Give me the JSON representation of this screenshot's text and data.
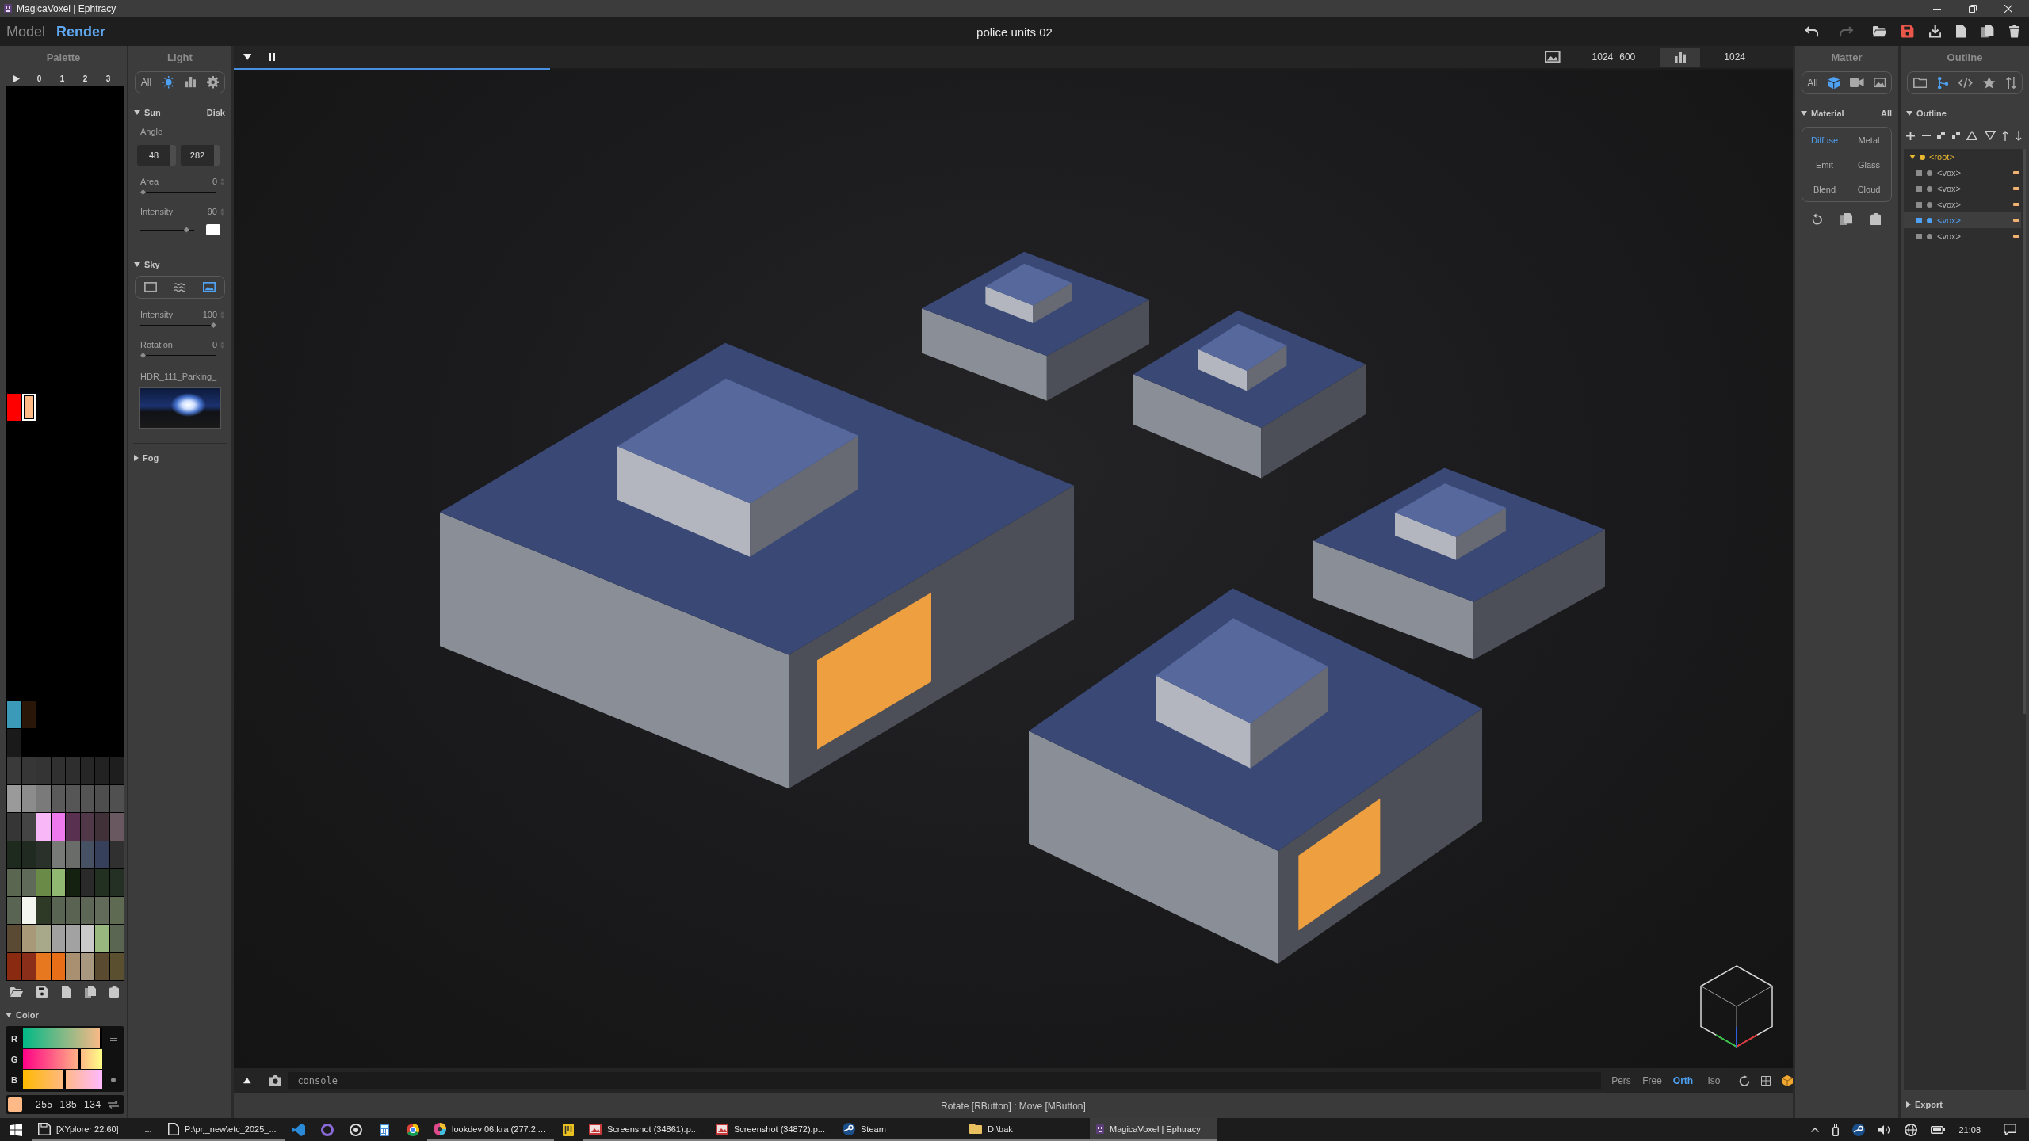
{
  "window": {
    "title": "MagicaVoxel | Ephtracy"
  },
  "toolbar": {
    "undo": {
      "disabled": false
    },
    "redo": {
      "disabled": true
    }
  },
  "modes": [
    {
      "label": "Model",
      "selected": false
    },
    {
      "label": "Render",
      "selected": true
    }
  ],
  "document": {
    "title": "police units 02"
  },
  "palette": {
    "title": "Palette",
    "pages": [
      {
        "label": "0",
        "selected": false
      },
      {
        "label": "1",
        "selected": false
      },
      {
        "label": "2",
        "selected": false
      },
      {
        "label": "3",
        "selected": false
      }
    ],
    "rows": [
      {
        "cells": [
          null,
          null,
          null,
          null,
          null,
          null,
          null,
          null
        ]
      },
      {
        "cells": [
          null,
          null,
          null,
          null,
          null,
          null,
          null,
          null
        ]
      },
      {
        "cells": [
          null,
          null,
          null,
          null,
          null,
          null,
          null,
          null
        ]
      },
      {
        "cells": [
          null,
          null,
          null,
          null,
          null,
          null,
          null,
          null
        ]
      },
      {
        "cells": [
          null,
          null,
          null,
          null,
          null,
          null,
          null,
          null
        ]
      },
      {
        "cells": [
          null,
          null,
          null,
          null,
          null,
          null,
          null,
          null
        ]
      },
      {
        "cells": [
          null,
          null,
          null,
          null,
          null,
          null,
          null,
          null
        ]
      },
      {
        "cells": [
          null,
          null,
          null,
          null,
          null,
          null,
          null,
          null
        ]
      },
      {
        "cells": [
          null,
          null,
          null,
          null,
          null,
          null,
          null,
          null
        ]
      },
      {
        "cells": [
          null,
          null,
          null,
          null,
          null,
          null,
          null,
          null
        ]
      },
      {
        "cells": [
          null,
          null,
          null,
          null,
          null,
          null,
          null,
          null
        ]
      },
      {
        "cells": [
          {
            "color": "#ff0000",
            "selected": false
          },
          {
            "color": "#ffb986",
            "selected": true
          },
          null,
          null,
          null,
          null,
          null,
          null
        ]
      },
      {
        "cells": [
          null,
          null,
          null,
          null,
          null,
          null,
          null,
          null
        ]
      },
      {
        "cells": [
          null,
          null,
          null,
          null,
          null,
          null,
          null,
          null
        ]
      },
      {
        "cells": [
          null,
          null,
          null,
          null,
          null,
          null,
          null,
          null
        ]
      },
      {
        "cells": [
          null,
          null,
          null,
          null,
          null,
          null,
          null,
          null
        ]
      },
      {
        "cells": [
          null,
          null,
          null,
          null,
          null,
          null,
          null,
          null
        ]
      },
      {
        "cells": [
          null,
          null,
          null,
          null,
          null,
          null,
          null,
          null
        ]
      },
      {
        "cells": [
          null,
          null,
          null,
          null,
          null,
          null,
          null,
          null
        ]
      },
      {
        "cells": [
          null,
          null,
          null,
          null,
          null,
          null,
          null,
          null
        ]
      },
      {
        "cells": [
          null,
          null,
          null,
          null,
          null,
          null,
          null,
          null
        ]
      },
      {
        "cells": [
          null,
          null,
          null,
          null,
          null,
          null,
          null,
          null
        ]
      },
      {
        "cells": [
          {
            "color": "#3a9ab8",
            "selected": false
          },
          {
            "color": "#2a1608",
            "selected": false
          },
          null,
          null,
          null,
          null,
          null,
          null
        ]
      },
      {
        "cells": [
          {
            "color": "#1a1a1a",
            "selected": false
          },
          null,
          null,
          null,
          null,
          null,
          null,
          null
        ]
      },
      {
        "cells": [
          {
            "color": "#3a3a3a",
            "selected": false
          },
          {
            "color": "#363636",
            "selected": false
          },
          {
            "color": "#343434",
            "selected": false
          },
          {
            "color": "#303030",
            "selected": false
          },
          {
            "color": "#2e2e2e",
            "selected": false
          },
          {
            "color": "#262626",
            "selected": false
          },
          {
            "color": "#222222",
            "selected": false
          },
          {
            "color": "#1e1e1e",
            "selected": false
          }
        ]
      },
      {
        "cells": [
          {
            "color": "#9a9a9a",
            "selected": false
          },
          {
            "color": "#8c8c8c",
            "selected": false
          },
          {
            "color": "#7a7a7a",
            "selected": false
          },
          {
            "color": "#5a5a5a",
            "selected": false
          },
          {
            "color": "#565656",
            "selected": false
          },
          {
            "color": "#545454",
            "selected": false
          },
          {
            "color": "#4e4e4e",
            "selected": false
          },
          {
            "color": "#505050",
            "selected": false
          }
        ]
      },
      {
        "cells": [
          {
            "color": "#363636",
            "selected": false
          },
          {
            "color": "#444444",
            "selected": false
          },
          {
            "color": "#f8b8f8",
            "selected": false
          },
          {
            "color": "#ee78ee",
            "selected": false
          },
          {
            "color": "#5a3050",
            "selected": false
          },
          {
            "color": "#503848",
            "selected": false
          },
          {
            "color": "#403038",
            "selected": false
          },
          {
            "color": "#6a5860",
            "selected": false
          }
        ]
      },
      {
        "cells": [
          {
            "color": "#1e2a1e",
            "selected": false
          },
          {
            "color": "#202a20",
            "selected": false
          },
          {
            "color": "#2a302a",
            "selected": false
          },
          {
            "color": "#787a78",
            "selected": false
          },
          {
            "color": "#6a6c6a",
            "selected": false
          },
          {
            "color": "#465264",
            "selected": false
          },
          {
            "color": "#36405a",
            "selected": false
          },
          {
            "color": "#303030",
            "selected": false
          }
        ]
      },
      {
        "cells": [
          {
            "color": "#5a6650",
            "selected": false
          },
          {
            "color": "#606a58",
            "selected": false
          },
          {
            "color": "#6a8a48",
            "selected": false
          },
          {
            "color": "#90b870",
            "selected": false
          },
          {
            "color": "#142010",
            "selected": false
          },
          {
            "color": "#2a2a2a",
            "selected": false
          },
          {
            "color": "#223022",
            "selected": false
          },
          {
            "color": "#243024",
            "selected": false
          }
        ]
      },
      {
        "cells": [
          {
            "color": "#5a6452",
            "selected": false
          },
          {
            "color": "#f2f6ee",
            "selected": false
          },
          {
            "color": "#2e3a26",
            "selected": false
          },
          {
            "color": "#5a6452",
            "selected": false
          },
          {
            "color": "#5a6252",
            "selected": false
          },
          {
            "color": "#5e6656",
            "selected": false
          },
          {
            "color": "#626a5a",
            "selected": false
          },
          {
            "color": "#5e6a52",
            "selected": false
          }
        ]
      },
      {
        "cells": [
          {
            "color": "#5a4a34",
            "selected": false
          },
          {
            "color": "#a89a78",
            "selected": false
          },
          {
            "color": "#a8a88a",
            "selected": false
          },
          {
            "color": "#a0a0a0",
            "selected": false
          },
          {
            "color": "#a2a2a2",
            "selected": false
          },
          {
            "color": "#cacaca",
            "selected": false
          },
          {
            "color": "#98b880",
            "selected": false
          },
          {
            "color": "#5a6652",
            "selected": false
          }
        ]
      },
      {
        "cells": [
          {
            "color": "#8a2a10",
            "selected": false
          },
          {
            "color": "#8a2e1a",
            "selected": false
          },
          {
            "color": "#e87820",
            "selected": false
          },
          {
            "color": "#e86e18",
            "selected": false
          },
          {
            "color": "#a89070",
            "selected": false
          },
          {
            "color": "#a89880",
            "selected": false
          },
          {
            "color": "#5a4a30",
            "selected": false
          },
          {
            "color": "#5a5030",
            "selected": false
          }
        ]
      }
    ]
  },
  "color": {
    "title": "Color",
    "expanded": true,
    "channels": [
      {
        "label": "R",
        "level": 1
      },
      {
        "label": "G",
        "level": 0.725
      },
      {
        "label": "B",
        "level": 0.525
      }
    ],
    "values": [
      "255",
      "185",
      "134"
    ]
  },
  "light": {
    "title": "Light",
    "filters": [
      {
        "kind": "text",
        "label": "All",
        "selected": false
      },
      {
        "kind": "sun",
        "selected": true
      },
      {
        "kind": "chart",
        "selected": false
      },
      {
        "kind": "gear",
        "selected": false
      }
    ],
    "sun": {
      "title": "Sun",
      "expanded": true,
      "mode": "Disk",
      "angle_label": "Angle",
      "angle": [
        "48",
        "282"
      ],
      "area": {
        "label": "Area",
        "value": "0",
        "level": 0
      },
      "intensity": {
        "label": "Intensity",
        "value": "90",
        "level": 0.9
      }
    },
    "sky": {
      "title": "Sky",
      "expanded": true,
      "types": [
        {
          "kind": "plain",
          "selected": false
        },
        {
          "kind": "waves",
          "selected": false
        },
        {
          "kind": "image",
          "selected": true
        }
      ],
      "intensity": {
        "label": "Intensity",
        "value": "100",
        "level": 1
      },
      "rotation": {
        "label": "Rotation",
        "value": "0",
        "level": 0
      },
      "hdr_name": "HDR_111_Parking_"
    },
    "fog": {
      "title": "Fog",
      "expanded": false
    }
  },
  "viewport": {
    "progress": {
      "level": 0.203
    },
    "size": [
      "1024",
      "600"
    ],
    "samples": "1024",
    "console": {
      "placeholder": "console"
    },
    "projections": [
      {
        "label": "Pers",
        "selected": false
      },
      {
        "label": "Free",
        "selected": false
      },
      {
        "label": "Orth",
        "selected": true
      },
      {
        "label": "Iso",
        "selected": false
      }
    ],
    "status": "Rotate [RButton] : Move [MButton]"
  },
  "matter": {
    "title": "Matter",
    "filters": [
      {
        "kind": "text",
        "label": "All",
        "selected": false
      },
      {
        "kind": "cube",
        "selected": true
      },
      {
        "kind": "video",
        "selected": false
      },
      {
        "kind": "image",
        "selected": false
      }
    ],
    "material": {
      "title": "Material",
      "expanded": true,
      "scope": "All",
      "types": [
        {
          "label": "Diffuse",
          "selected": true
        },
        {
          "label": "Metal",
          "selected": false
        },
        {
          "label": "Emit",
          "selected": false
        },
        {
          "label": "Glass",
          "selected": false
        },
        {
          "label": "Blend",
          "selected": false
        },
        {
          "label": "Cloud",
          "selected": false
        }
      ]
    }
  },
  "outline": {
    "title": "Outline",
    "filters": [
      {
        "kind": "folder",
        "selected": false
      },
      {
        "kind": "tree",
        "selected": true
      },
      {
        "kind": "code",
        "selected": false
      },
      {
        "kind": "star",
        "selected": false
      },
      {
        "kind": "sort",
        "selected": false
      }
    ],
    "section": {
      "title": "Outline",
      "expanded": true
    },
    "tree": [
      {
        "label": "<root>",
        "expanded": true,
        "selected": false,
        "children": [
          {
            "label": "<vox>",
            "selected": false
          },
          {
            "label": "<vox>",
            "selected": false
          },
          {
            "label": "<vox>",
            "selected": false
          },
          {
            "label": "<vox>",
            "selected": true
          },
          {
            "label": "<vox>",
            "selected": false
          }
        ]
      }
    ],
    "export": {
      "title": "Export",
      "expanded": false
    }
  },
  "taskbar": {
    "items": [
      {
        "label": "[XYplorer 22.60]",
        "active": false
      },
      {
        "label": "...",
        "active": false
      },
      {
        "label": "P:\\prj_new\\etc_2025_...",
        "active": false
      },
      {
        "label": "lookdev 06.kra (277.2 ...",
        "active": false
      },
      {
        "label": "Screenshot (34861).p...",
        "active": false
      },
      {
        "label": "Screenshot (34872).p...",
        "active": false
      },
      {
        "label": "Steam",
        "active": false
      },
      {
        "label": "D:\\bak",
        "active": false
      },
      {
        "label": "MagicaVoxel | Ephtracy",
        "active": true
      }
    ],
    "clock": "21:08"
  }
}
